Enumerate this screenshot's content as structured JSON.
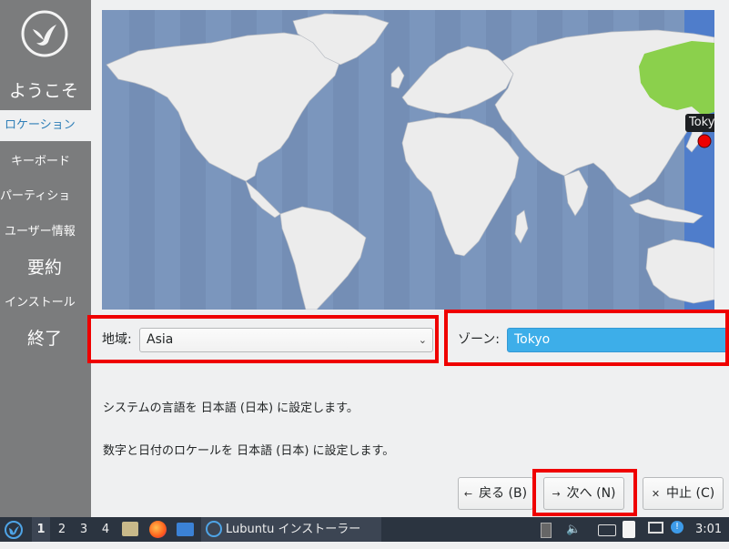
{
  "sidebar": {
    "items": [
      {
        "label": "ようこそ",
        "size": "big"
      },
      {
        "label": "ロケーション",
        "size": "small",
        "active": true
      },
      {
        "label": "キーボード",
        "size": "small"
      },
      {
        "label": "パーティショ",
        "size": "small"
      },
      {
        "label": "ユーザー情報",
        "size": "small"
      },
      {
        "label": "要約",
        "size": "big"
      },
      {
        "label": "インストール",
        "size": "small"
      },
      {
        "label": "終了",
        "size": "big"
      }
    ]
  },
  "map": {
    "timezone_label": "Tokyo"
  },
  "location": {
    "region_label": "地域:",
    "region_value": "Asia",
    "zone_label": "ゾーン:",
    "zone_value": "Tokyo"
  },
  "info": {
    "language_line": "システムの言語を 日本語 (日本) に設定します。",
    "locale_line": "数字と日付のロケールを 日本語 (日本) に設定します。"
  },
  "buttons": {
    "back": "戻る (B)",
    "next": "次へ (N)",
    "cancel": "中止 (C)"
  },
  "taskbar": {
    "workspaces": [
      "1",
      "2",
      "3",
      "4"
    ],
    "active_workspace": "1",
    "window_title": "Lubuntu インストーラー",
    "clock": "3:01"
  },
  "colors": {
    "sidebar_bg": "#7b7c7d",
    "map_ocean": "#7b96bd",
    "highlight_zone": "#4f7dcb",
    "highlight_country": "#8bd04c",
    "selection": "#3daee9",
    "annotation_red": "#ef0000",
    "taskbar_bg": "#2b3440"
  },
  "icons": {
    "logo": "lubuntu-bird-icon",
    "back": "arrow-left-icon",
    "next": "arrow-right-icon",
    "cancel": "close-icon",
    "menu": "lubuntu-menu-icon",
    "files": "file-manager-icon",
    "browser": "firefox-icon",
    "desktop": "show-desktop-icon",
    "window": "lubuntu-installer-icon",
    "battery": "battery-icon",
    "volume": "volume-icon",
    "keyboard": "keyboard-icon",
    "clipboard": "clipboard-icon",
    "monitor": "monitor-icon",
    "notification": "notification-icon"
  }
}
